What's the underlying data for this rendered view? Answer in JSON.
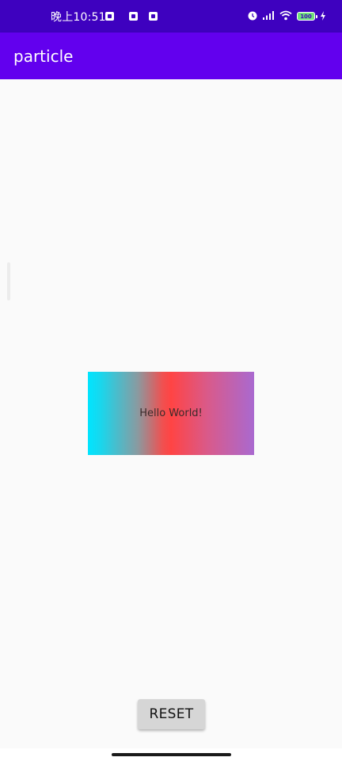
{
  "status_bar": {
    "time": "晚上10:51",
    "notification_icons": [
      "app-notification-icon",
      "app-notification-icon",
      "app-notification-icon"
    ],
    "battery": "100",
    "icons": [
      "alarm-icon",
      "cellular-signal-icon",
      "wifi-icon",
      "battery-icon",
      "charging-icon"
    ]
  },
  "app_bar": {
    "title": "particle",
    "color": "#6200ee"
  },
  "main": {
    "hello_text": "Hello World!",
    "gradient_colors": [
      "#00e5ff",
      "#ff4444",
      "#a969d0"
    ]
  },
  "actions": {
    "reset_label": "RESET"
  }
}
